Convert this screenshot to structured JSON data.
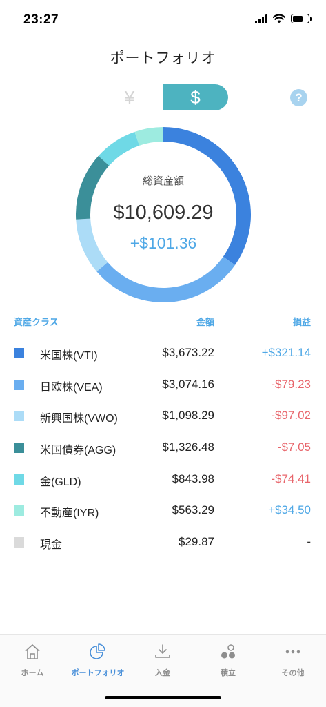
{
  "status_bar": {
    "time": "23:27"
  },
  "header": {
    "title": "ポートフォリオ"
  },
  "currency_toggle": {
    "yen_label": "¥",
    "usd_label": "$"
  },
  "help": {
    "label": "?"
  },
  "summary": {
    "label": "総資産額",
    "total": "$10,609.29",
    "change": "+$101.36"
  },
  "table": {
    "headers": {
      "asset_class": "資産クラス",
      "amount": "金額",
      "gain": "損益"
    },
    "rows": [
      {
        "name": "米国株(VTI)",
        "amount": "$3,673.22",
        "gain": "+$321.14",
        "sign": "pos",
        "color": "#3b82de",
        "value": 3673.22
      },
      {
        "name": "日欧株(VEA)",
        "amount": "$3,074.16",
        "gain": "-$79.23",
        "sign": "neg",
        "color": "#6aaef0",
        "value": 3074.16
      },
      {
        "name": "新興国株(VWO)",
        "amount": "$1,098.29",
        "gain": "-$97.02",
        "sign": "neg",
        "color": "#acdcf7",
        "value": 1098.29
      },
      {
        "name": "米国債券(AGG)",
        "amount": "$1,326.48",
        "gain": "-$7.05",
        "sign": "neg",
        "color": "#3b8f99",
        "value": 1326.48
      },
      {
        "name": "金(GLD)",
        "amount": "$843.98",
        "gain": "-$74.41",
        "sign": "neg",
        "color": "#6fd9e6",
        "value": 843.98
      },
      {
        "name": "不動産(IYR)",
        "amount": "$563.29",
        "gain": "+$34.50",
        "sign": "pos",
        "color": "#9debe0",
        "value": 563.29
      },
      {
        "name": "現金",
        "amount": "$29.87",
        "gain": "-",
        "sign": "neutral",
        "color": "#dadada",
        "value": 29.87
      }
    ]
  },
  "tabs": [
    {
      "label": "ホーム",
      "icon": "home-icon",
      "active": false
    },
    {
      "label": "ポートフォリオ",
      "icon": "portfolio-pie-icon",
      "active": true
    },
    {
      "label": "入金",
      "icon": "deposit-download-icon",
      "active": false
    },
    {
      "label": "積立",
      "icon": "savings-coins-icon",
      "active": false
    },
    {
      "label": "その他",
      "icon": "more-dots-icon",
      "active": false
    }
  ],
  "colors": {
    "accent": "#4db3c0",
    "positive": "#4fa8e6",
    "negative": "#e8656b",
    "tab_active": "#4a90d9"
  }
}
